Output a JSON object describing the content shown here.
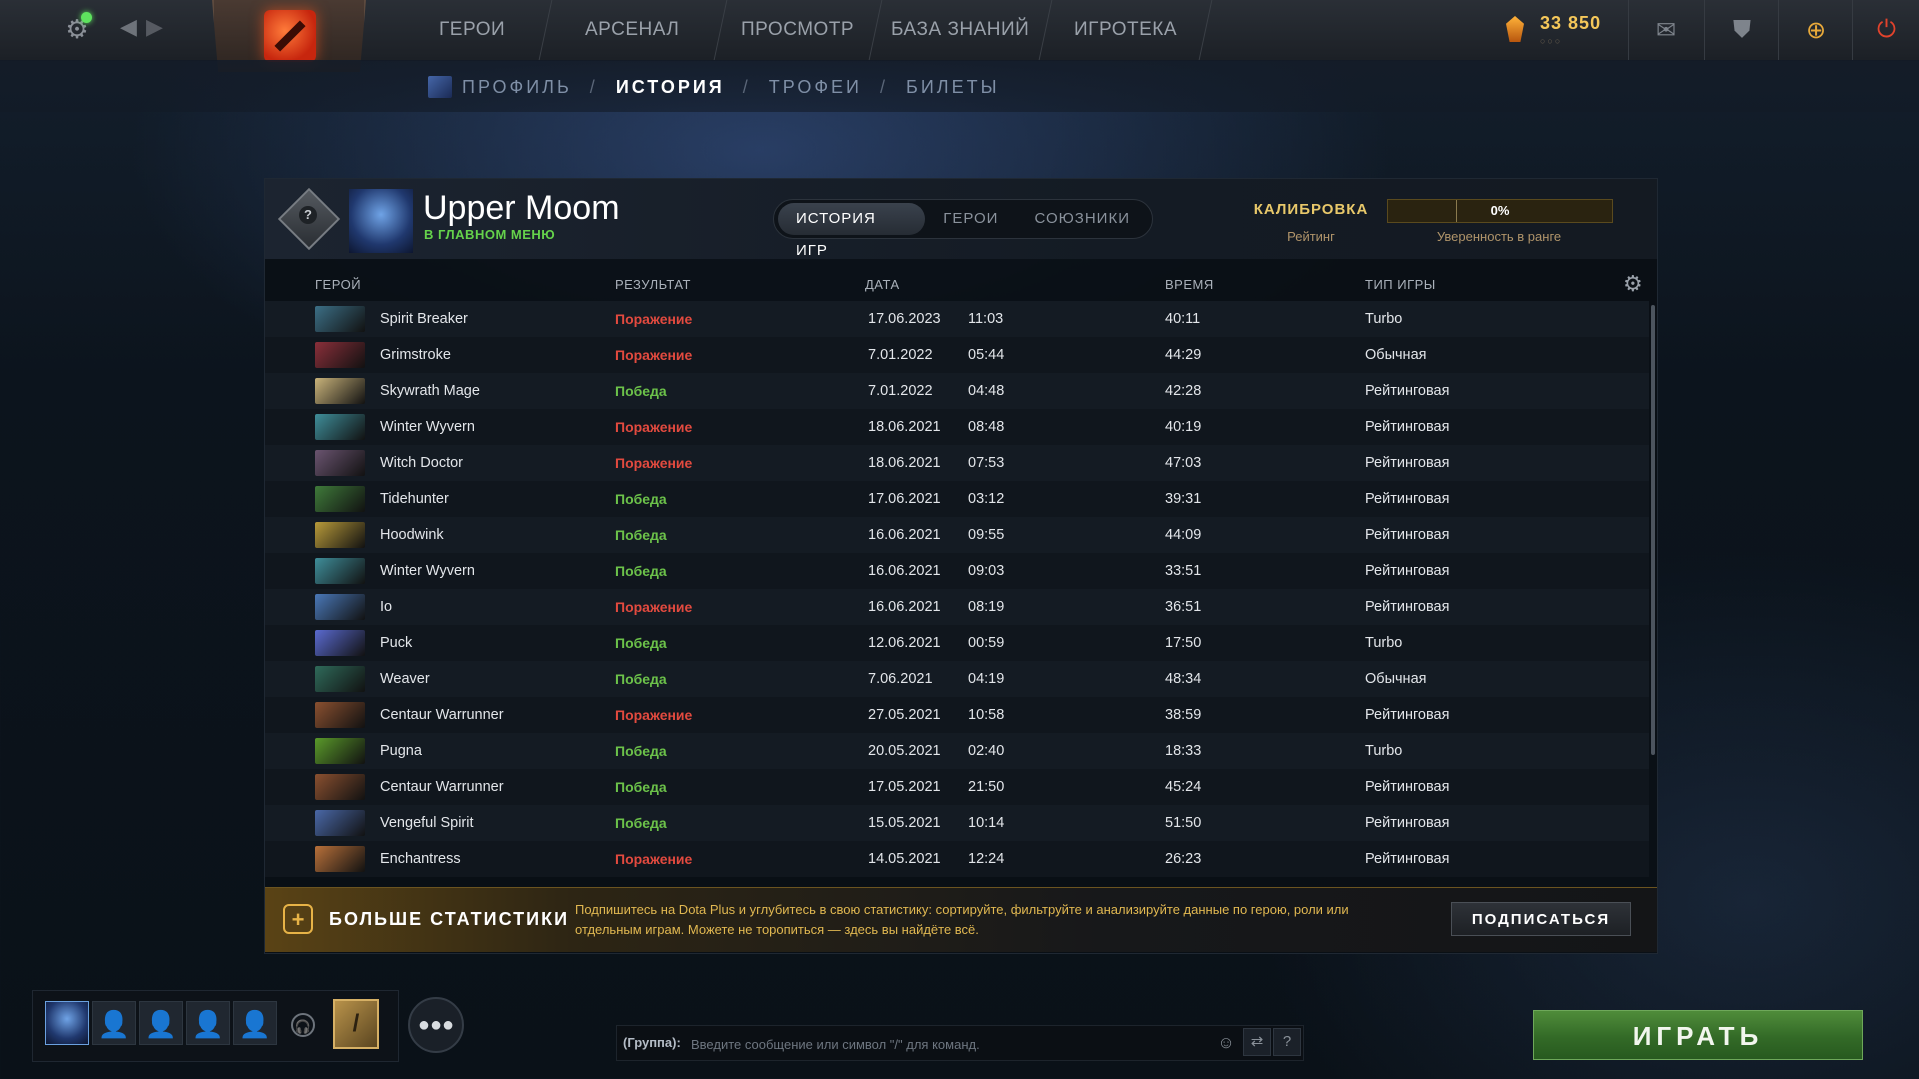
{
  "topbar": {
    "nav": [
      "ГЕРОИ",
      "АРСЕНАЛ",
      "ПРОСМОТР",
      "БАЗА ЗНАНИЙ",
      "ИГРОТЕКА"
    ],
    "currency_major": "33",
    "currency_minor": "850",
    "currency_dots": "○○○",
    "icons": [
      "settings-icon",
      "back-icon",
      "forward-icon",
      "mail-icon",
      "shield-icon",
      "dota-plus-icon",
      "power-icon"
    ],
    "status_color": "#5ee35e"
  },
  "subnav": {
    "items": [
      "ПРОФИЛЬ",
      "ИСТОРИЯ",
      "ТРОФЕИ",
      "БИЛЕТЫ"
    ],
    "separator": "/",
    "active": "ИСТОРИЯ"
  },
  "profile": {
    "name": "Upper Moom",
    "status": "В ГЛАВНОМ МЕНЮ",
    "rank_symbol": "?"
  },
  "tabs": [
    "ИСТОРИЯ ИГР",
    "ГЕРОИ",
    "СОЮЗНИКИ"
  ],
  "calibration": {
    "title": "КАЛИБРОВКА",
    "rating_label": "Рейтинг",
    "confidence_value": "0%",
    "confidence_label": "Уверенность в ранге",
    "confidence_fraction": 0
  },
  "table": {
    "headers": {
      "hero": "ГЕРОЙ",
      "result": "РЕЗУЛЬТАТ",
      "date": "ДАТА",
      "time": "ВРЕМЯ",
      "type": "ТИП ИГРЫ"
    },
    "rows": [
      {
        "hero": "Spirit Breaker",
        "result": "Поражение",
        "win": false,
        "date": "17.06.2023",
        "clock": "11:03",
        "duration": "40:11",
        "type": "Turbo",
        "color": "#3c6f86"
      },
      {
        "hero": "Grimstroke",
        "result": "Поражение",
        "win": false,
        "date": "7.01.2022",
        "clock": "05:44",
        "duration": "44:29",
        "type": "Обычная",
        "color": "#8a2f3a"
      },
      {
        "hero": "Skywrath Mage",
        "result": "Победа",
        "win": true,
        "date": "7.01.2022",
        "clock": "04:48",
        "duration": "42:28",
        "type": "Рейтинговая",
        "color": "#c9b37a"
      },
      {
        "hero": "Winter Wyvern",
        "result": "Поражение",
        "win": false,
        "date": "18.06.2021",
        "clock": "08:48",
        "duration": "40:19",
        "type": "Рейтинговая",
        "color": "#3f8e9a"
      },
      {
        "hero": "Witch Doctor",
        "result": "Поражение",
        "win": false,
        "date": "18.06.2021",
        "clock": "07:53",
        "duration": "47:03",
        "type": "Рейтинговая",
        "color": "#6a5470"
      },
      {
        "hero": "Tidehunter",
        "result": "Победа",
        "win": true,
        "date": "17.06.2021",
        "clock": "03:12",
        "duration": "39:31",
        "type": "Рейтинговая",
        "color": "#3f7a3a"
      },
      {
        "hero": "Hoodwink",
        "result": "Победа",
        "win": true,
        "date": "16.06.2021",
        "clock": "09:55",
        "duration": "44:09",
        "type": "Рейтинговая",
        "color": "#b89a3a"
      },
      {
        "hero": "Winter Wyvern",
        "result": "Победа",
        "win": true,
        "date": "16.06.2021",
        "clock": "09:03",
        "duration": "33:51",
        "type": "Рейтинговая",
        "color": "#3f8e9a"
      },
      {
        "hero": "Io",
        "result": "Поражение",
        "win": false,
        "date": "16.06.2021",
        "clock": "08:19",
        "duration": "36:51",
        "type": "Рейтинговая",
        "color": "#4a78b8"
      },
      {
        "hero": "Puck",
        "result": "Победа",
        "win": true,
        "date": "12.06.2021",
        "clock": "00:59",
        "duration": "17:50",
        "type": "Turbo",
        "color": "#5a6ad0"
      },
      {
        "hero": "Weaver",
        "result": "Победа",
        "win": true,
        "date": "7.06.2021",
        "clock": "04:19",
        "duration": "48:34",
        "type": "Обычная",
        "color": "#2f6a5a"
      },
      {
        "hero": "Centaur Warrunner",
        "result": "Поражение",
        "win": false,
        "date": "27.05.2021",
        "clock": "10:58",
        "duration": "38:59",
        "type": "Рейтинговая",
        "color": "#8a5030"
      },
      {
        "hero": "Pugna",
        "result": "Победа",
        "win": true,
        "date": "20.05.2021",
        "clock": "02:40",
        "duration": "18:33",
        "type": "Turbo",
        "color": "#5a9a2a"
      },
      {
        "hero": "Centaur Warrunner",
        "result": "Победа",
        "win": true,
        "date": "17.05.2021",
        "clock": "21:50",
        "duration": "45:24",
        "type": "Рейтинговая",
        "color": "#8a5030"
      },
      {
        "hero": "Vengeful Spirit",
        "result": "Победа",
        "win": true,
        "date": "15.05.2021",
        "clock": "10:14",
        "duration": "51:50",
        "type": "Рейтинговая",
        "color": "#4a68a8"
      },
      {
        "hero": "Enchantress",
        "result": "Поражение",
        "win": false,
        "date": "14.05.2021",
        "clock": "12:24",
        "duration": "26:23",
        "type": "Рейтинговая",
        "color": "#b8703a"
      }
    ]
  },
  "promo": {
    "title": "БОЛЬШЕ СТАТИСТИКИ",
    "text": "Подпишитесь на Dota Plus и углубитесь в свою статистику: сортируйте, фильтруйте и анализируйте данные по герою, роли или отдельным играм. Можете не торопиться — здесь вы найдёте всё.",
    "button": "ПОДПИСАТЬСЯ"
  },
  "chat": {
    "label": "(Группа):",
    "placeholder": "Введите сообщение или символ \"/\" для команд.",
    "help": "?"
  },
  "play_button": "ИГРАТЬ"
}
